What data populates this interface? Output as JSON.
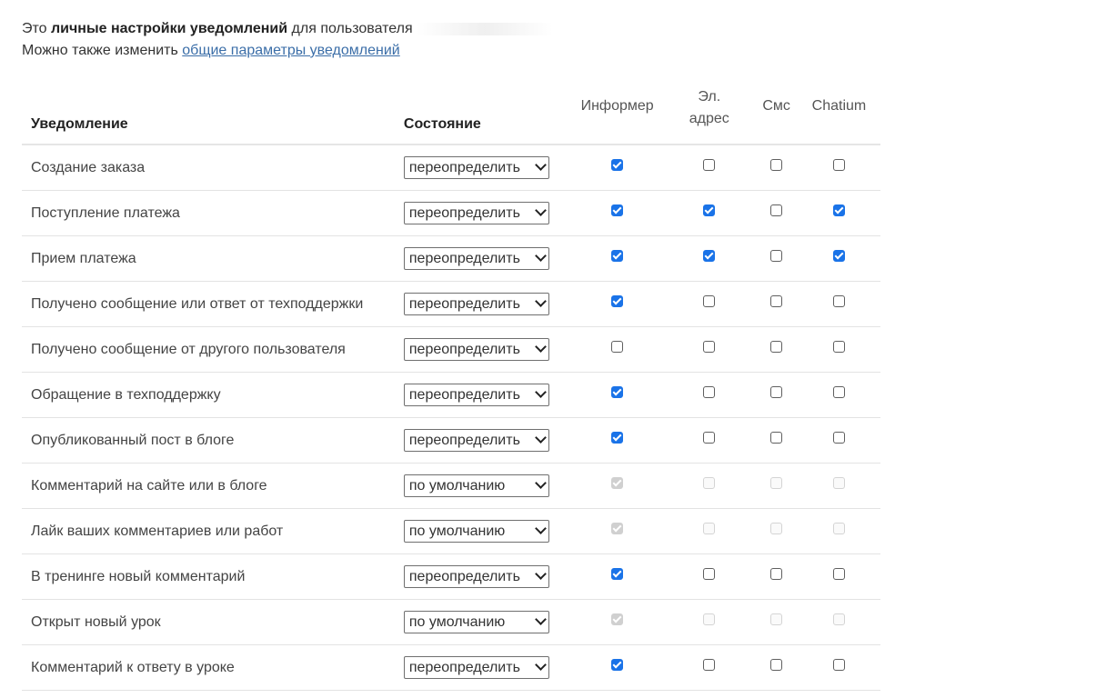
{
  "intro": {
    "line1_prefix": "Это",
    "line1_bold": "личные настройки уведомлений",
    "line1_suffix": "для пользователя",
    "line2_prefix": "Можно также изменить",
    "line2_link": "общие параметры уведомлений"
  },
  "columns": {
    "notification": "Уведомление",
    "state": "Состояние",
    "informer": "Информер",
    "email_line1": "Эл.",
    "email_line2": "адрес",
    "sms": "Смс",
    "chatium": "Chatium"
  },
  "colors": {
    "checkbox_accent": "#1a73e8",
    "link": "#3b6ea8"
  },
  "rows": [
    {
      "name": "Создание заказа",
      "state": "переопределить",
      "disabled": false,
      "informer": true,
      "email": false,
      "sms": false,
      "chatium": false
    },
    {
      "name": "Поступление платежа",
      "state": "переопределить",
      "disabled": false,
      "informer": true,
      "email": true,
      "sms": false,
      "chatium": true
    },
    {
      "name": "Прием платежа",
      "state": "переопределить",
      "disabled": false,
      "informer": true,
      "email": true,
      "sms": false,
      "chatium": true
    },
    {
      "name": "Получено сообщение или ответ от техподдержки",
      "state": "переопределить",
      "disabled": false,
      "informer": true,
      "email": false,
      "sms": false,
      "chatium": false
    },
    {
      "name": "Получено сообщение от другого пользователя",
      "state": "переопределить",
      "disabled": false,
      "informer": false,
      "email": false,
      "sms": false,
      "chatium": false
    },
    {
      "name": "Обращение в техподдержку",
      "state": "переопределить",
      "disabled": false,
      "informer": true,
      "email": false,
      "sms": false,
      "chatium": false
    },
    {
      "name": "Опубликованный пост в блоге",
      "state": "переопределить",
      "disabled": false,
      "informer": true,
      "email": false,
      "sms": false,
      "chatium": false
    },
    {
      "name": "Комментарий на сайте или в блоге",
      "state": "по умолчанию",
      "disabled": true,
      "informer": true,
      "email": false,
      "sms": false,
      "chatium": false
    },
    {
      "name": "Лайк ваших комментариев или работ",
      "state": "по умолчанию",
      "disabled": true,
      "informer": true,
      "email": false,
      "sms": false,
      "chatium": false
    },
    {
      "name": "В тренинге новый комментарий",
      "state": "переопределить",
      "disabled": false,
      "informer": true,
      "email": false,
      "sms": false,
      "chatium": false
    },
    {
      "name": "Открыт новый урок",
      "state": "по умолчанию",
      "disabled": true,
      "informer": true,
      "email": false,
      "sms": false,
      "chatium": false
    },
    {
      "name": "Комментарий к ответу в уроке",
      "state": "переопределить",
      "disabled": false,
      "informer": true,
      "email": false,
      "sms": false,
      "chatium": false
    }
  ]
}
